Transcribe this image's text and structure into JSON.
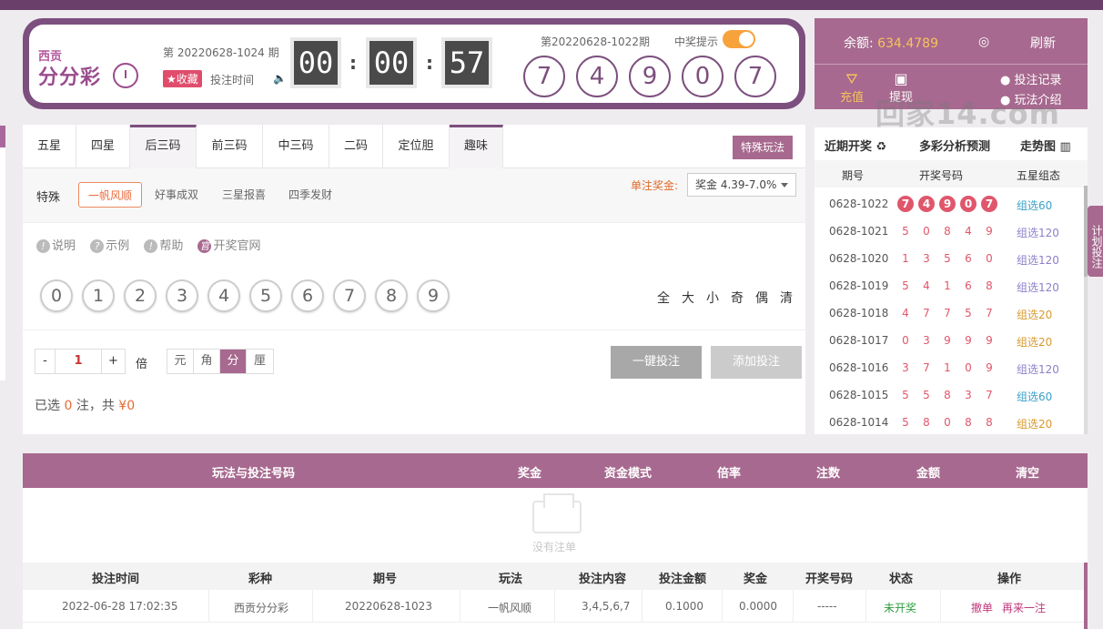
{
  "header": {
    "logo_line1": "西贡",
    "logo_line2": "分分彩",
    "issue_label": "第 20220628-1024 期",
    "favorite_label": "★收藏",
    "bet_time_label": "投注时间",
    "countdown": [
      "00",
      "00",
      "57"
    ],
    "prev_issue_label": "第20220628-1022期",
    "win_alert_label": "中奖提示",
    "balls": [
      "7",
      "4",
      "9",
      "0",
      "7"
    ]
  },
  "account": {
    "balance_label": "余额:",
    "balance_value": "634.4789",
    "refresh_label": "刷新",
    "charge_label": "充值",
    "withdraw_label": "提现",
    "records_label": "投注记录",
    "intro_label": "玩法介绍",
    "watermark": "回家14.com"
  },
  "tabs": [
    "五星",
    "四星",
    "后三码",
    "前三码",
    "中三码",
    "二码",
    "定位胆",
    "趣味"
  ],
  "special_button": "特殊玩法",
  "subbar": {
    "title": "特殊",
    "items": [
      "一帆风顺",
      "好事成双",
      "三星报喜",
      "四季发财"
    ],
    "prize_label": "单注奖金:",
    "prize_value": "奖金 4.39-7.0%"
  },
  "helps": [
    "说明",
    "示例",
    "帮助",
    "开奖官网"
  ],
  "numbers": [
    "0",
    "1",
    "2",
    "3",
    "4",
    "5",
    "6",
    "7",
    "8",
    "9"
  ],
  "quick_picks": [
    "全",
    "大",
    "小",
    "奇",
    "偶",
    "清"
  ],
  "controls": {
    "minus": "-",
    "multiplier": "1",
    "plus": "+",
    "bei_label": "倍",
    "units": [
      "元",
      "角",
      "分",
      "厘"
    ],
    "one_click_label": "一键投注",
    "add_bet_label": "添加投注",
    "selected_prefix": "已选",
    "selected_count": "0",
    "selected_mid": "注，共",
    "selected_amount": "¥0"
  },
  "recent": {
    "tab1": "近期开奖 ♻",
    "tab2": "多彩分析预测",
    "tab3": "走势图",
    "col_issue": "期号",
    "col_numbers": "开奖号码",
    "col_group": "五星组态",
    "rows": [
      {
        "issue": "0628-1022",
        "digits": [
          "7",
          "4",
          "9",
          "0",
          "7"
        ],
        "group": "组选60",
        "group_color": "#3aa0c8"
      },
      {
        "issue": "0628-1021",
        "digits": [
          "5",
          "0",
          "8",
          "4",
          "9"
        ],
        "group": "组选120",
        "group_color": "#8e7fc9"
      },
      {
        "issue": "0628-1020",
        "digits": [
          "1",
          "3",
          "5",
          "6",
          "0"
        ],
        "group": "组选120",
        "group_color": "#8e7fc9"
      },
      {
        "issue": "0628-1019",
        "digits": [
          "5",
          "4",
          "1",
          "6",
          "8"
        ],
        "group": "组选120",
        "group_color": "#8e7fc9"
      },
      {
        "issue": "0628-1018",
        "digits": [
          "4",
          "7",
          "7",
          "5",
          "7"
        ],
        "group": "组选20",
        "group_color": "#d79a2e"
      },
      {
        "issue": "0628-1017",
        "digits": [
          "0",
          "3",
          "9",
          "9",
          "9"
        ],
        "group": "组选20",
        "group_color": "#d79a2e"
      },
      {
        "issue": "0628-1016",
        "digits": [
          "3",
          "7",
          "1",
          "0",
          "9"
        ],
        "group": "组选120",
        "group_color": "#8e7fc9"
      },
      {
        "issue": "0628-1015",
        "digits": [
          "5",
          "5",
          "8",
          "3",
          "7"
        ],
        "group": "组选60",
        "group_color": "#3aa0c8"
      },
      {
        "issue": "0628-1014",
        "digits": [
          "5",
          "8",
          "0",
          "8",
          "8"
        ],
        "group": "组选20",
        "group_color": "#d79a2e"
      }
    ]
  },
  "side_tab_label": "计划投注",
  "bet_table": {
    "headers": [
      "玩法与投注号码",
      "奖金",
      "资金模式",
      "倍率",
      "注数",
      "金额",
      "清空"
    ],
    "empty_text": "没有注单"
  },
  "history": {
    "headers": [
      "投注时间",
      "彩种",
      "期号",
      "玩法",
      "投注内容",
      "投注金额",
      "奖金",
      "开奖号码",
      "状态",
      "操作"
    ],
    "row": {
      "time": "2022-06-28 17:02:35",
      "lottery": "西贡分分彩",
      "issue": "20220628-1023",
      "play": "一帆风顺",
      "content": "3,4,5,6,7",
      "amount": "0.1000",
      "prize": "0.0000",
      "draw": "-----",
      "status": "未开奖",
      "cancel": "撤单",
      "again": "再来一注"
    }
  },
  "colors": {
    "brand": "#7c4f7e",
    "accent": "#a7698f",
    "gold": "#f7c35a",
    "red": "#e0566b"
  }
}
